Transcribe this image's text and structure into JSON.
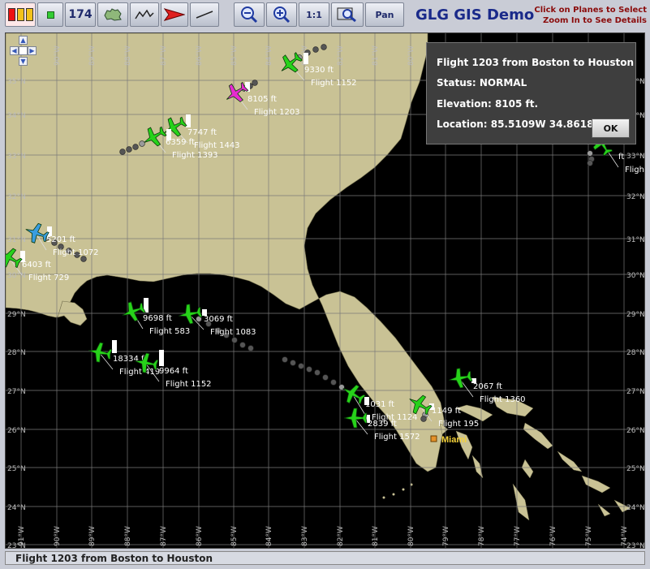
{
  "toolbar": {
    "count_label": "174",
    "zoom_1_1_label": "1:1",
    "pan_label": "Pan"
  },
  "app_title": "GLG GIS Demo",
  "hint": {
    "line1": "Click on Planes to Select",
    "line2": "Zoom In to See Details"
  },
  "popup": {
    "title": "Flight 1203 from Boston to Houston",
    "status": "Status: NORMAL",
    "elevation": "Elevation: 8105 ft.",
    "location": "Location: 85.5109W 34.8618S",
    "ok_label": "OK"
  },
  "status_bar": "Flight 1203 from Boston to Houston",
  "city": "Miami",
  "lat_labels": [
    "35°N",
    "34°N",
    "33°N",
    "32°N",
    "31°N",
    "30°N",
    "29°N",
    "28°N",
    "27°N",
    "26°N",
    "25°N",
    "24°N",
    "23°N"
  ],
  "lon_labels": [
    "91°W",
    "90°W",
    "89°W",
    "88°W",
    "87°W",
    "86°W",
    "85°W",
    "84°W",
    "83°W",
    "82°W",
    "81°W",
    "80°W",
    "79°W",
    "78°W",
    "77°W",
    "76°W",
    "75°W",
    "74°W"
  ],
  "flights": [
    {
      "flight": "Flight 1152",
      "alt": "9330 ft",
      "status": "normal"
    },
    {
      "flight": "Flight 1203",
      "alt": "8105 ft",
      "status": "selected"
    },
    {
      "flight": "Flight 1443",
      "alt": "7747 ft",
      "status": "normal"
    },
    {
      "flight": "Flight 1393",
      "alt": "6359 ft",
      "status": "normal"
    },
    {
      "flight": "Flight 1072",
      "alt": "5201 ft",
      "status": "alert"
    },
    {
      "flight": "Flight 729",
      "alt": "6403 ft",
      "status": "normal"
    },
    {
      "flight": "Flight 583",
      "alt": "9698 ft",
      "status": "normal"
    },
    {
      "flight": "Flight 1083",
      "alt": "3069 ft",
      "status": "normal"
    },
    {
      "flight": "Flight 419",
      "alt": "18334 ft",
      "status": "normal"
    },
    {
      "flight": "Flight 1152",
      "alt": "9964 ft",
      "status": "normal"
    },
    {
      "flight": "Flight 1124",
      "alt": "1031 ft",
      "status": "normal"
    },
    {
      "flight": "Flight 1572",
      "alt": "2839 ft",
      "status": "normal"
    },
    {
      "flight": "Flight 195",
      "alt": "1149 ft",
      "status": "normal"
    },
    {
      "flight": "Flight 1360",
      "alt": "2067 ft",
      "status": "normal"
    },
    {
      "flight": "Flight",
      "alt": "ft",
      "status": "normal"
    }
  ],
  "colors": {
    "land": "#c9c295",
    "water": "#000000",
    "normal_plane": "#27d21a",
    "selected_plane": "#e62bd0",
    "alert_plane": "#3a9de0",
    "city": "#f5d23a"
  }
}
